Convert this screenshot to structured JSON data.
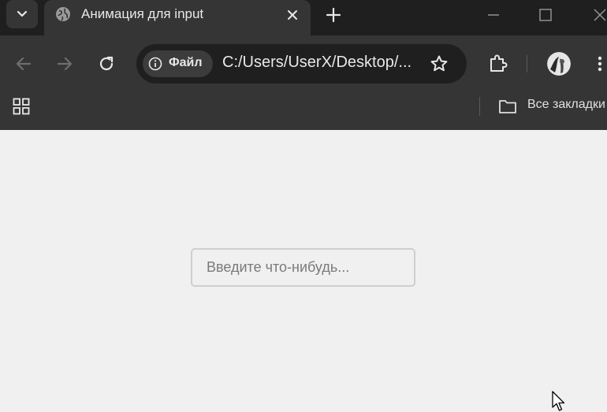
{
  "browser": {
    "tab": {
      "title": "Анимация для input"
    },
    "address_bar": {
      "site_chip_label": "Файл",
      "url": "C:/Users/UserX/Desktop/..."
    },
    "bookmarks_bar": {
      "all_bookmarks_label": "Все закладки"
    }
  },
  "page": {
    "input": {
      "placeholder": "Введите что-нибудь...",
      "value": ""
    }
  },
  "icons": [
    "chevron-down-icon",
    "globe-icon",
    "close-icon",
    "plus-icon",
    "minimize-icon",
    "maximize-icon",
    "back-arrow-icon",
    "forward-arrow-icon",
    "reload-icon",
    "info-icon",
    "star-icon",
    "puzzle-icon",
    "avatar",
    "kebab-menu-icon",
    "apps-grid-icon",
    "folder-icon",
    "mouse-cursor-icon"
  ],
  "colors": {
    "tabstrip_bg": "#1f1f1f",
    "toolbar_bg": "#353535",
    "omnibox_bg": "#1f1f1f",
    "page_bg": "#f0f0f0",
    "input_border": "#cfcfcf"
  }
}
